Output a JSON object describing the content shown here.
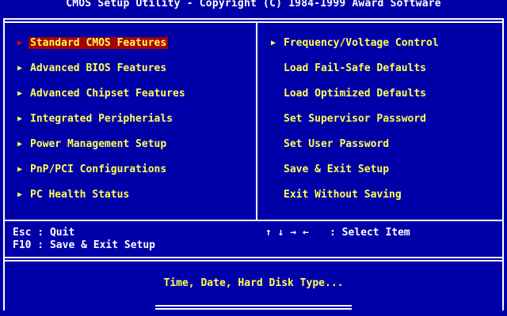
{
  "title": "CMOS Setup Utility - Copyright (C) 1984-1999 Award Software",
  "left_menu": [
    {
      "label": "Standard CMOS Features",
      "arrow": true,
      "selected": true
    },
    {
      "label": "Advanced BIOS Features",
      "arrow": true
    },
    {
      "label": "Advanced Chipset Features",
      "arrow": true
    },
    {
      "label": "Integrated Peripherials",
      "arrow": true
    },
    {
      "label": "Power Management Setup",
      "arrow": true
    },
    {
      "label": "PnP/PCI Configurations",
      "arrow": true
    },
    {
      "label": "PC Health Status",
      "arrow": true
    }
  ],
  "right_menu": [
    {
      "label": "Frequency/Voltage Control",
      "arrow": true
    },
    {
      "label": "Load Fail-Safe Defaults",
      "arrow": false
    },
    {
      "label": "Load Optimized Defaults",
      "arrow": false
    },
    {
      "label": "Set Supervisor Password",
      "arrow": false
    },
    {
      "label": "Set User Password",
      "arrow": false
    },
    {
      "label": "Save & Exit Setup",
      "arrow": false
    },
    {
      "label": "Exit Without Saving",
      "arrow": false
    }
  ],
  "keys": {
    "esc": "Esc : Quit",
    "f10": "F10 : Save & Exit Setup",
    "arrows": "↑ ↓ → ←",
    "select_item": ": Select Item"
  },
  "help_text": "Time, Date, Hard Disk Type...",
  "colors": {
    "background": "#0000a8",
    "menu_text": "#ffff54",
    "selected_bg": "#a80000",
    "frame": "#ffffff"
  }
}
